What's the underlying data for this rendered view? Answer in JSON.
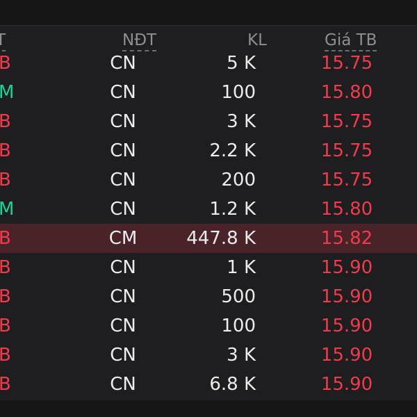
{
  "header": {
    "col_side": "T",
    "col_investor": "NĐT",
    "col_volume": "KL",
    "col_avg_price": "Giá TB"
  },
  "colors": {
    "buy": "#19d29a",
    "sell": "#ef3b4b",
    "highlight_row": "#4a2329"
  },
  "rows": [
    {
      "side": "B",
      "investor": "CN",
      "volume": "5 K",
      "price": "15.75"
    },
    {
      "side": "M",
      "investor": "CN",
      "volume": "100",
      "price": "15.80"
    },
    {
      "side": "B",
      "investor": "CN",
      "volume": "3 K",
      "price": "15.75"
    },
    {
      "side": "B",
      "investor": "CN",
      "volume": "2.2 K",
      "price": "15.75"
    },
    {
      "side": "B",
      "investor": "CN",
      "volume": "200",
      "price": "15.75"
    },
    {
      "side": "M",
      "investor": "CN",
      "volume": "1.2 K",
      "price": "15.80"
    },
    {
      "side": "B",
      "investor": "CM",
      "volume": "447.8 K",
      "price": "15.82"
    },
    {
      "side": "B",
      "investor": "CN",
      "volume": "1 K",
      "price": "15.90"
    },
    {
      "side": "B",
      "investor": "CN",
      "volume": "500",
      "price": "15.90"
    },
    {
      "side": "B",
      "investor": "CN",
      "volume": "100",
      "price": "15.90"
    },
    {
      "side": "B",
      "investor": "CN",
      "volume": "3 K",
      "price": "15.90"
    },
    {
      "side": "B",
      "investor": "CN",
      "volume": "6.8 K",
      "price": "15.90"
    }
  ]
}
